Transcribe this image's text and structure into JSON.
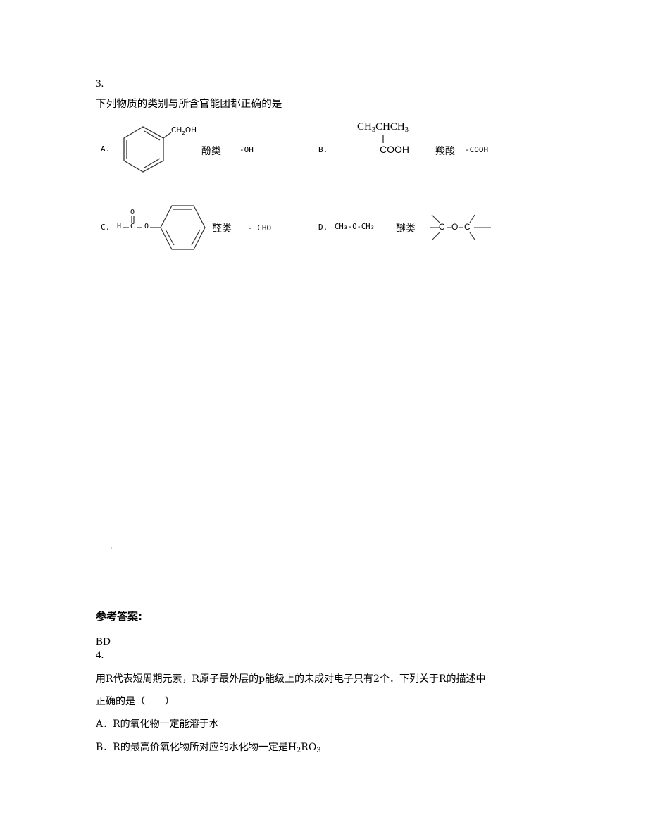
{
  "question3": {
    "number": "3.",
    "stem": "下列物质的类别与所含官能团都正确的是",
    "options": [
      {
        "label": "A.",
        "structure_substituent": "CH",
        "structure_sub": "2",
        "structure_tail": "OH",
        "class_name": "酚类",
        "functional_group": "-OH"
      },
      {
        "label": "B.",
        "structure_top": "CH",
        "structure_top_sub1": "3",
        "structure_top_mid": "CHCH",
        "structure_top_sub2": "3",
        "structure_bottom": "COOH",
        "class_name": "羧酸",
        "functional_group": "-COOH"
      },
      {
        "label": "C.",
        "structure_h": "H",
        "structure_c": "C",
        "structure_o_top": "O",
        "structure_o": "O",
        "class_name": "醛类",
        "functional_group": "- CHO"
      },
      {
        "label": "D.",
        "structure": "CH₃-O-CH₃",
        "class_name": "醚类",
        "functional_group_c1": "C",
        "functional_group_o": "O",
        "functional_group_c2": "C"
      }
    ]
  },
  "answer_section": {
    "heading": "参考答案:",
    "answer": "BD"
  },
  "question4": {
    "number": "4.",
    "stem_line1": "用R代表短周期元素，R原子最外层的p能级上的未成对电子只有2个．下列关于R的描述中",
    "stem_line2": "正确的是（　　）",
    "options": [
      {
        "text": "A．R的氧化物一定能溶于水"
      },
      {
        "text_prefix": "B．R的最高价氧化物所对应的水化物一定是H",
        "sub1": "2",
        "mid": "RO",
        "sub2": "3"
      }
    ]
  }
}
